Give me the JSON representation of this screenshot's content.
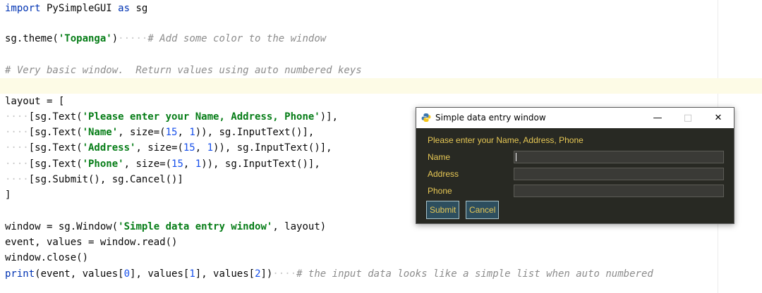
{
  "editor": {
    "line1": {
      "kw1": "import",
      "mod": " PySimpleGUI ",
      "kw2": "as",
      "alias": " sg"
    },
    "line2": {
      "pre": "sg.theme(",
      "str": "'Topanga'",
      "post": ")",
      "dots": "·····",
      "cmt": "# Add some color to the window"
    },
    "line3": {
      "cmt": "# Very basic window.  Return values using auto numbered keys"
    },
    "line4": {
      "text": "layout = ["
    },
    "line5": {
      "ind": "····",
      "pre": "[sg.Text(",
      "str": "'Please enter your Name, Address, Phone'",
      "post": ")],"
    },
    "line6": {
      "ind": "····",
      "pre": "[sg.Text(",
      "str": "'Name'",
      "mid": ", size=(",
      "n1": "15",
      "sep": ", ",
      "n2": "1",
      "post": ")), sg.InputText()],"
    },
    "line7": {
      "ind": "····",
      "pre": "[sg.Text(",
      "str": "'Address'",
      "mid": ", size=(",
      "n1": "15",
      "sep": ", ",
      "n2": "1",
      "post": ")), sg.InputText()],"
    },
    "line8": {
      "ind": "····",
      "pre": "[sg.Text(",
      "str": "'Phone'",
      "mid": ", size=(",
      "n1": "15",
      "sep": ", ",
      "n2": "1",
      "post": ")), sg.InputText()],"
    },
    "line9": {
      "ind": "····",
      "text": "[sg.Submit(), sg.Cancel()]"
    },
    "line10": {
      "text": "]"
    },
    "line11": {
      "pre": "window = sg.Window(",
      "str": "'Simple data entry window'",
      "post": ", layout)"
    },
    "line12": {
      "text": "event, values = window.read()"
    },
    "line13": {
      "text": "window.close()"
    },
    "line14": {
      "kw": "print",
      "a": "(event, values[",
      "n0": "0",
      "b": "], values[",
      "n1": "1",
      "c": "], values[",
      "n2": "2",
      "d": "])",
      "dots": "····",
      "cmt": "# the input data looks like a simple list when auto numbered"
    }
  },
  "window": {
    "title": "Simple data entry window",
    "minimize": "—",
    "maximize": "□",
    "close": "✕",
    "prompt": "Please enter your Name, Address, Phone",
    "fields": [
      {
        "label": "Name",
        "value": ""
      },
      {
        "label": "Address",
        "value": ""
      },
      {
        "label": "Phone",
        "value": ""
      }
    ],
    "submit_label": "Submit",
    "cancel_label": "Cancel",
    "theme": {
      "background": "#282923",
      "text": "#e7c855",
      "button_bg": "#2d4e5e",
      "input_bg": "#3a3a36"
    }
  }
}
